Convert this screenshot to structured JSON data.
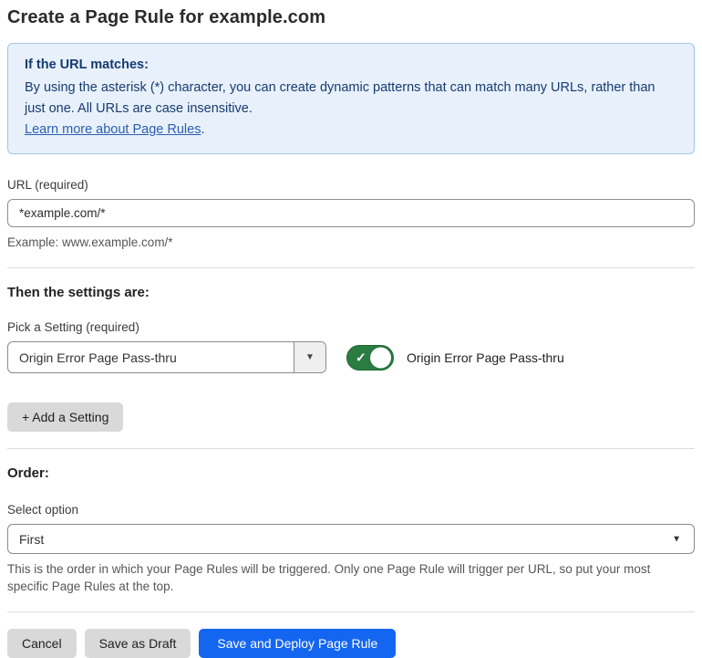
{
  "page": {
    "title": "Create a Page Rule for example.com"
  },
  "info_box": {
    "heading": "If the URL matches:",
    "body": "By using the asterisk (*) character, you can create dynamic patterns that can match many URLs, rather than just one. All URLs are case insensitive.",
    "link_label": "Learn more about Page Rules",
    "link_suffix": ".",
    "background_color": "#e8f1fb",
    "border_color": "#a5c6ea",
    "text_color": "#173b70",
    "link_color": "#2b5db0"
  },
  "url_field": {
    "label": "URL (required)",
    "value": "*example.com/*",
    "helper": "Example: www.example.com/*"
  },
  "settings_section": {
    "heading": "Then the settings are:",
    "picker_label": "Pick a Setting (required)",
    "picker_value": "Origin Error Page Pass-thru",
    "toggle": {
      "state": "on",
      "label": "Origin Error Page Pass-thru",
      "on_color": "#2a7c41",
      "check_glyph": "✓"
    },
    "add_button_label": "+ Add a Setting"
  },
  "order_section": {
    "heading": "Order:",
    "select_label": "Select option",
    "select_value": "First",
    "helper": "This is the order in which your Page Rules will be triggered. Only one Page Rule will trigger per URL, so put your most specific Page Rules at the top."
  },
  "footer": {
    "cancel_label": "Cancel",
    "save_draft_label": "Save as Draft",
    "save_deploy_label": "Save and Deploy Page Rule",
    "primary_color": "#1466f1"
  },
  "icons": {
    "dropdown_caret": "▼"
  }
}
